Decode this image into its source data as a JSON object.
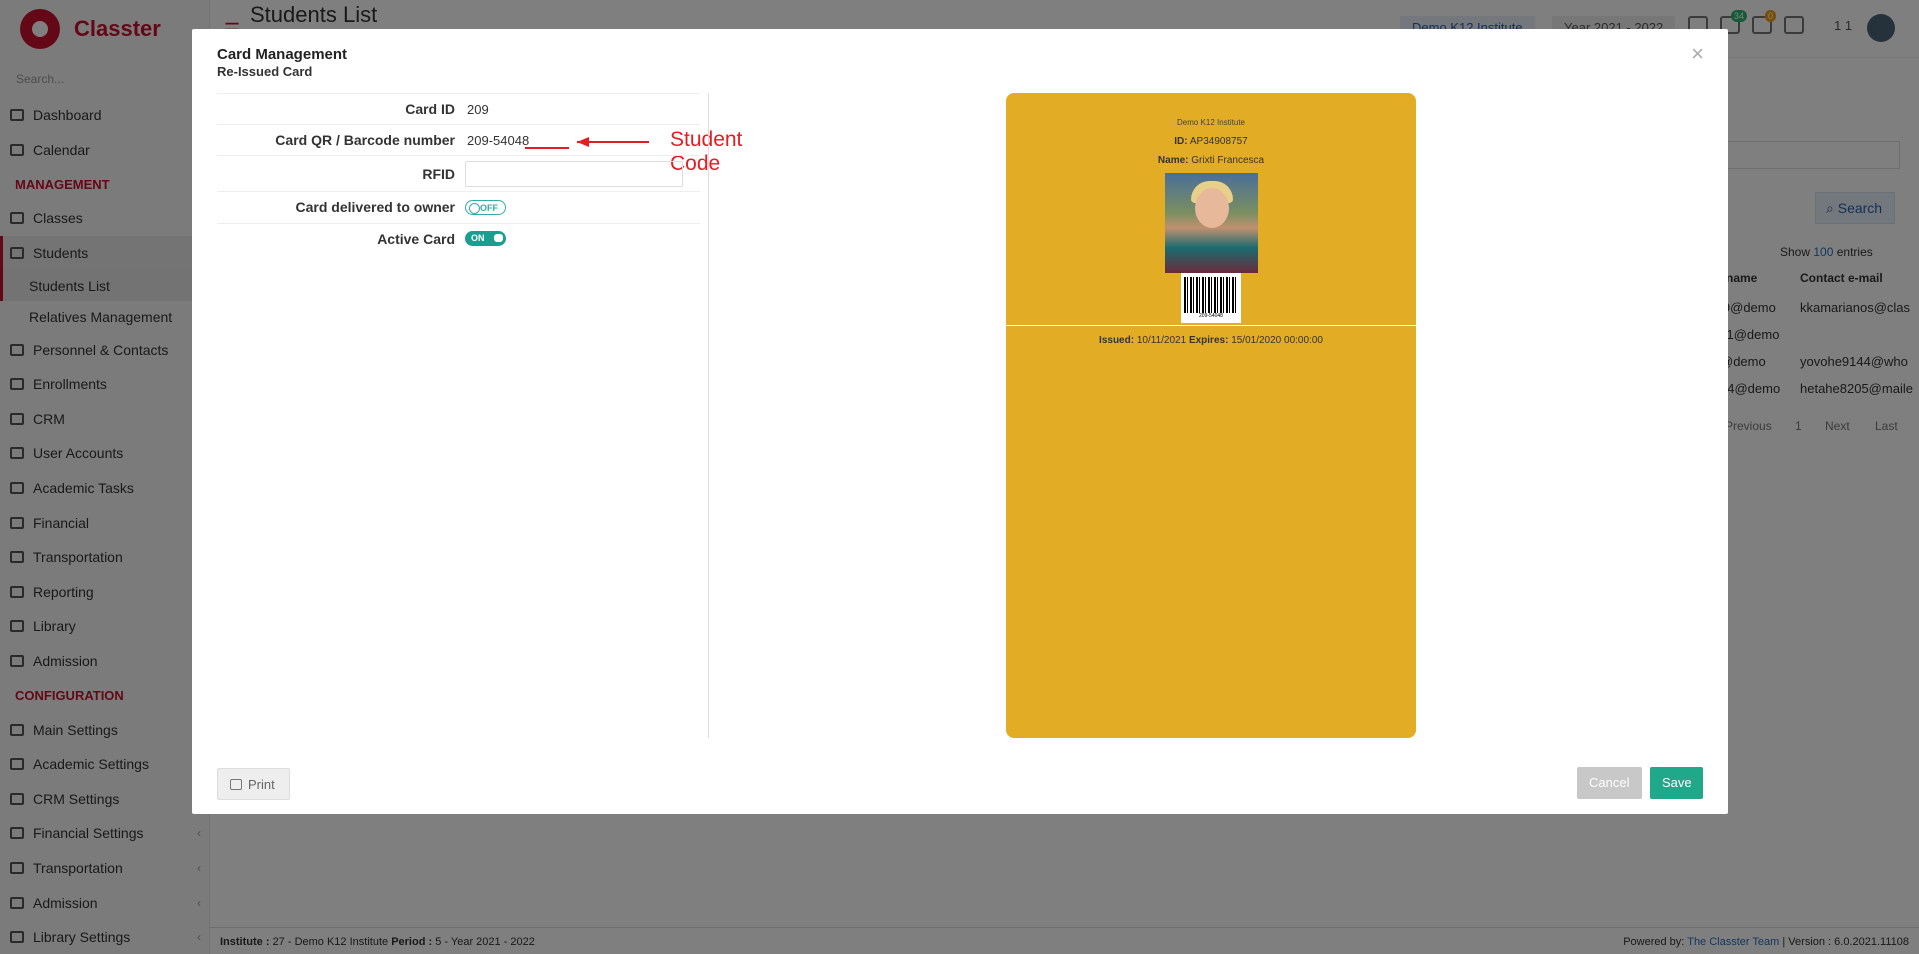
{
  "app": {
    "brand": "Classter",
    "page_title": "Students List"
  },
  "sidebar": {
    "search_placeholder": "Search...",
    "items": [
      {
        "label": "Dashboard"
      },
      {
        "label": "Calendar"
      }
    ],
    "management_label": "MANAGEMENT",
    "management": [
      {
        "label": "Classes"
      },
      {
        "label": "Students"
      },
      {
        "label": "Students List"
      },
      {
        "label": "Relatives Management"
      },
      {
        "label": "Personnel & Contacts"
      },
      {
        "label": "Enrollments"
      },
      {
        "label": "CRM"
      },
      {
        "label": "User Accounts"
      },
      {
        "label": "Academic Tasks"
      },
      {
        "label": "Financial"
      },
      {
        "label": "Transportation"
      },
      {
        "label": "Reporting"
      },
      {
        "label": "Library"
      },
      {
        "label": "Admission"
      }
    ],
    "configuration_label": "CONFIGURATION",
    "configuration": [
      {
        "label": "Main Settings"
      },
      {
        "label": "Academic Settings"
      },
      {
        "label": "CRM Settings"
      },
      {
        "label": "Financial Settings"
      },
      {
        "label": "Transportation"
      },
      {
        "label": "Admission"
      },
      {
        "label": "Library Settings"
      }
    ]
  },
  "topbar": {
    "institute": "Demo K12 Institute",
    "year": "Year 2021 - 2022",
    "badge_green": "34",
    "badge_orange": "0",
    "user_short": "1 1"
  },
  "background_list": {
    "search_button": "Search",
    "show_prefix": "Show",
    "show_count": "100",
    "show_suffix": "entries",
    "col_name": "name",
    "col_email": "Contact e-mail",
    "rows": [
      {
        "name": "i9@demo",
        "email": "kkamarianos@clas"
      },
      {
        "name": "ti1@demo",
        "email": ""
      },
      {
        "name": "@demo",
        "email": "yovohe9144@who"
      },
      {
        "name": "h4@demo",
        "email": "hetahe8205@maile"
      }
    ],
    "pager": {
      "previous": "Previous",
      "page": "1",
      "next": "Next",
      "last": "Last"
    }
  },
  "footer": {
    "institute_label": "Institute :",
    "institute_value": "27 - Demo K12 Institute",
    "period_label": "Period :",
    "period_value": "5 - Year 2021 - 2022",
    "powered_label": "Powered by:",
    "powered_link": "The Classter Team",
    "version": "| Version : 6.0.2021.11108"
  },
  "modal": {
    "title": "Card Management",
    "subtitle": "Re-Issued Card",
    "close": "×",
    "fields": {
      "card_id_label": "Card ID",
      "card_id_value": "209",
      "barcode_label": "Card QR / Barcode number",
      "barcode_value": "209-54048",
      "rfid_label": "RFID",
      "rfid_value": "",
      "delivered_label": "Card delivered to owner",
      "delivered_state": "OFF",
      "active_label": "Active Card",
      "active_state": "ON"
    },
    "annotation": "Student Code",
    "card": {
      "institute": "Demo K12 Institute",
      "id_label": "ID:",
      "id_value": "AP34908757",
      "name_label": "Name:",
      "name_value": "Grixti Francesca",
      "barcode_text": "209-54048",
      "issued_label": "Issued:",
      "issued_value": "10/11/2021",
      "expires_label": "Expires:",
      "expires_value": "15/01/2020 00:00:00",
      "background_color": "#e3ac25"
    },
    "buttons": {
      "print": "Print",
      "cancel": "Cancel",
      "save": "Save"
    }
  },
  "colors": {
    "brand": "#c8102e",
    "save": "#1fa98a",
    "annotation": "#e51c23"
  }
}
